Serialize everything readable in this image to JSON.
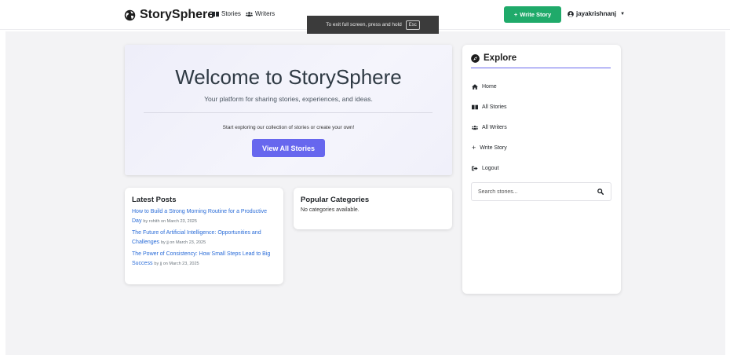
{
  "nav": {
    "brand": "StorySphere",
    "links": [
      "Stories",
      "Writers"
    ],
    "write_button": "Write Story",
    "user": "jayakrishnanj"
  },
  "fullscreen_notice": {
    "text": "To exit full screen, press and hold",
    "key": "Esc"
  },
  "hero": {
    "title": "Welcome to StorySphere",
    "subtitle": "Your platform for sharing stories, experiences, and ideas.",
    "text": "Start exploring our collection of stories or create your own!",
    "button": "View All Stories"
  },
  "latest_posts": {
    "title": "Latest Posts",
    "posts": [
      {
        "title": "How to Build a Strong Morning Routine for a Productive Day",
        "meta": "by rohith on March 23, 2025"
      },
      {
        "title": "The Future of Artificial Intelligence: Opportunities and Challenges",
        "meta": "by jj on March 23, 2025"
      },
      {
        "title": "The Power of Consistency: How Small Steps Lead to Big Success",
        "meta": "by jj on March 23, 2025"
      }
    ]
  },
  "popular_categories": {
    "title": "Popular Categories",
    "empty": "No categories available."
  },
  "explore": {
    "title": "Explore",
    "items": [
      "Home",
      "All Stories",
      "All Writers",
      "Write Story",
      "Logout"
    ],
    "search_placeholder": "Search stories..."
  },
  "colors": {
    "accent": "#6767ee",
    "success": "#1faa6a",
    "link": "#2a6cd8"
  },
  "icons": {
    "brand": "globe-icon",
    "stories": "book-open-icon",
    "writers": "users-icon",
    "write": "plus-icon",
    "user": "user-circle-icon",
    "explore": "compass-icon",
    "home": "home-icon",
    "logout": "sign-out-icon",
    "search": "search-icon"
  }
}
